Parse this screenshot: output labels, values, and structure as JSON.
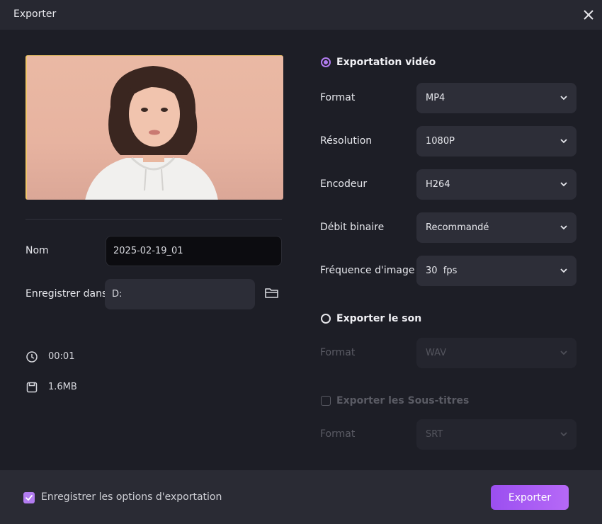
{
  "window": {
    "title": "Exporter"
  },
  "left": {
    "name_label": "Nom",
    "name_value": "2025-02-19_01",
    "save_label": "Enregistrer dans",
    "save_value": "D:",
    "duration": "00:01",
    "size": "1.6MB"
  },
  "video": {
    "section_label": "Exportation vidéo",
    "rows": [
      {
        "label": "Format",
        "value": "MP4"
      },
      {
        "label": "Résolution",
        "value": "1080P"
      },
      {
        "label": "Encodeur",
        "value": "H264"
      },
      {
        "label": "Débit binaire",
        "value": "Recommandé"
      },
      {
        "label": "Fréquence d'image",
        "value": "30  fps"
      }
    ]
  },
  "audio": {
    "section_label": "Exporter le son",
    "format_label": "Format",
    "format_value": "WAV"
  },
  "subtitles": {
    "section_label": "Exporter les Sous-titres",
    "format_label": "Format",
    "format_value": "SRT"
  },
  "footer": {
    "remember_label": "Enregistrer les options d'exportation",
    "export_label": "Exporter"
  },
  "colors": {
    "accent": "#b27cf0",
    "background": "#1d1e26",
    "panel": "#2d2e38"
  }
}
